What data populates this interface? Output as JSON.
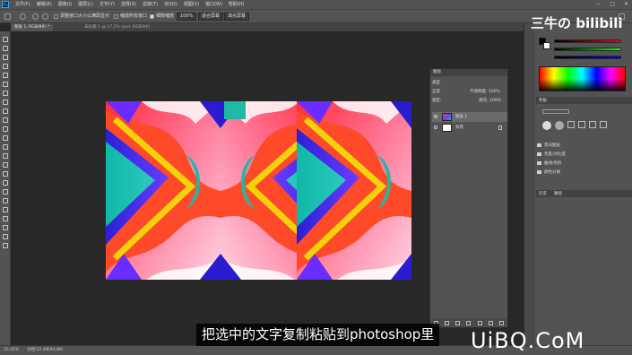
{
  "app": {
    "logo": "Ps",
    "menu": [
      "文件(F)",
      "编辑(E)",
      "图像(I)",
      "图层(L)",
      "文字(Y)",
      "选择(S)",
      "滤镜(T)",
      "3D(D)",
      "视图(V)",
      "窗口(W)",
      "帮助(H)"
    ],
    "window_controls": [
      "—",
      "□",
      "✕"
    ]
  },
  "options_bar": {
    "zoom_100": "100%",
    "check1": "调整窗口大小以满屏显示",
    "check2": "缩放所有窗口",
    "check3": "细微缩放",
    "btn_100": "100%",
    "fit_screen": "适合屏幕",
    "fill_screen": "填充屏幕"
  },
  "tabs": [
    {
      "label": "图层 1, RGB/8#) *",
      "active": true
    },
    {
      "label": "未标题-1 @ 17.2% (psd, RGB/8#)",
      "active": false
    }
  ],
  "layers_panel": {
    "title": "图层",
    "kind": "类型",
    "blend_mode": "正常",
    "opacity_label": "不透明度:",
    "opacity_value": "100%",
    "lock_label": "锁定:",
    "fill_label": "填充:",
    "fill_value": "100%",
    "layers": [
      {
        "name": "图层 1",
        "selected": true,
        "thumb": "pattern"
      },
      {
        "name": "背景",
        "selected": false,
        "thumb": "white",
        "locked": true
      }
    ]
  },
  "dock": {
    "color_tab": "颜色",
    "swatches_tab": "色板",
    "libraries_tab": "库",
    "library_items": [
      "黑白图层",
      "亮度/对比度",
      "曲线/色阶",
      "颜色分离"
    ],
    "paths_tab": "路径",
    "history_tab": "历史"
  },
  "status": {
    "zoom": "33.41%",
    "doc": "文档:22.4M/44.8M"
  },
  "subtitle": "把选中的文字复制粘贴到photoshop里",
  "watermark_bili": "三牛の bilibili",
  "watermark_site": "UiBQ.CoM",
  "colors": {
    "panel": "#535353",
    "workspace": "#282828",
    "accent": "#31a8ff"
  }
}
